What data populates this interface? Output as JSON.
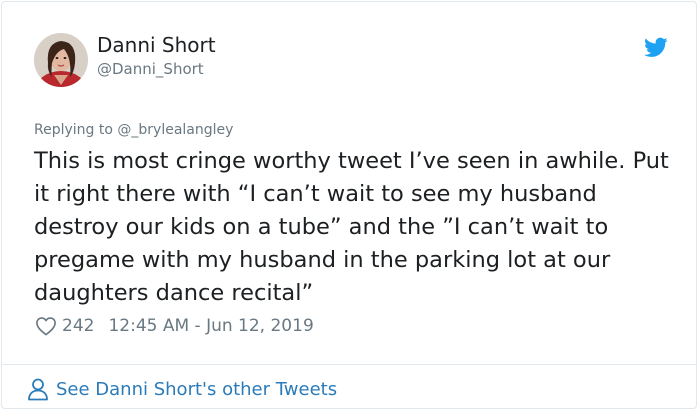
{
  "author": {
    "name": "Danni Short",
    "handle": "@Danni_Short"
  },
  "icons": {
    "brand": "twitter-bird-icon",
    "like": "heart-icon",
    "profile": "person-icon"
  },
  "reply": {
    "prefix": "Replying to",
    "mention": "@_brylealangley"
  },
  "tweet": {
    "text": "This is most cringe worthy tweet I’ve seen in awhile. Put it right there with “I can’t wait to see my husband destroy our kids on a tube” and the ”I can’t wait to pregame with my husband in the parking lot at our daughters dance recital”"
  },
  "meta": {
    "likes": "242",
    "timestamp": "12:45 AM - Jun 12, 2019"
  },
  "footer": {
    "see_more": "See Danni Short's other Tweets"
  },
  "colors": {
    "brand_blue": "#1da1f2",
    "link_blue": "#2b7bb9",
    "muted": "#697882",
    "text": "#1c2022",
    "border": "#e1e8ed"
  }
}
